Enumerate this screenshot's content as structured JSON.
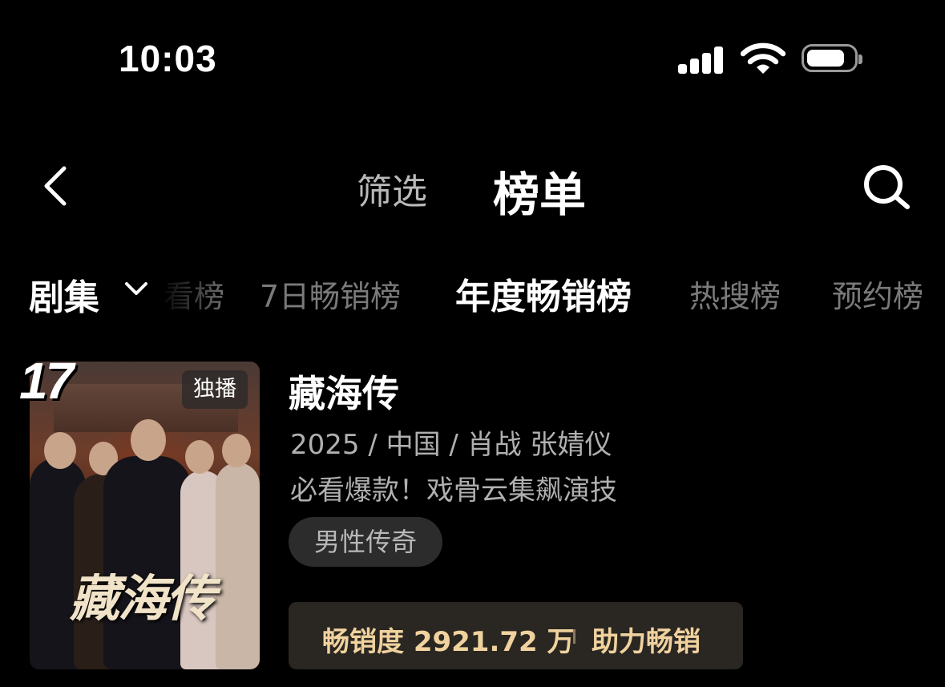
{
  "status": {
    "time": "10:03"
  },
  "header": {
    "filter_tab": "筛选",
    "rank_tab": "榜单"
  },
  "category": {
    "label": "剧集"
  },
  "ranking_tabs": [
    {
      "label": "看榜",
      "active": false
    },
    {
      "label": "7日畅销榜",
      "active": false
    },
    {
      "label": "年度畅销榜",
      "active": true
    },
    {
      "label": "热搜榜",
      "active": false
    },
    {
      "label": "预约榜",
      "active": false
    }
  ],
  "item": {
    "rank": "17",
    "badge": "独播",
    "poster_title": "藏海传",
    "title": "藏海传",
    "meta": "2025 / 中国 / 肖战 张婧仪",
    "description": "必看爆款！戏骨云集飙演技",
    "tag": "男性传奇",
    "sales_label": "畅销度 2921.72 万",
    "help_label": "助力畅销"
  },
  "colors": {
    "background": "#000000",
    "sales_text": "#f0d29e",
    "sales_bg": "#2a2622"
  }
}
